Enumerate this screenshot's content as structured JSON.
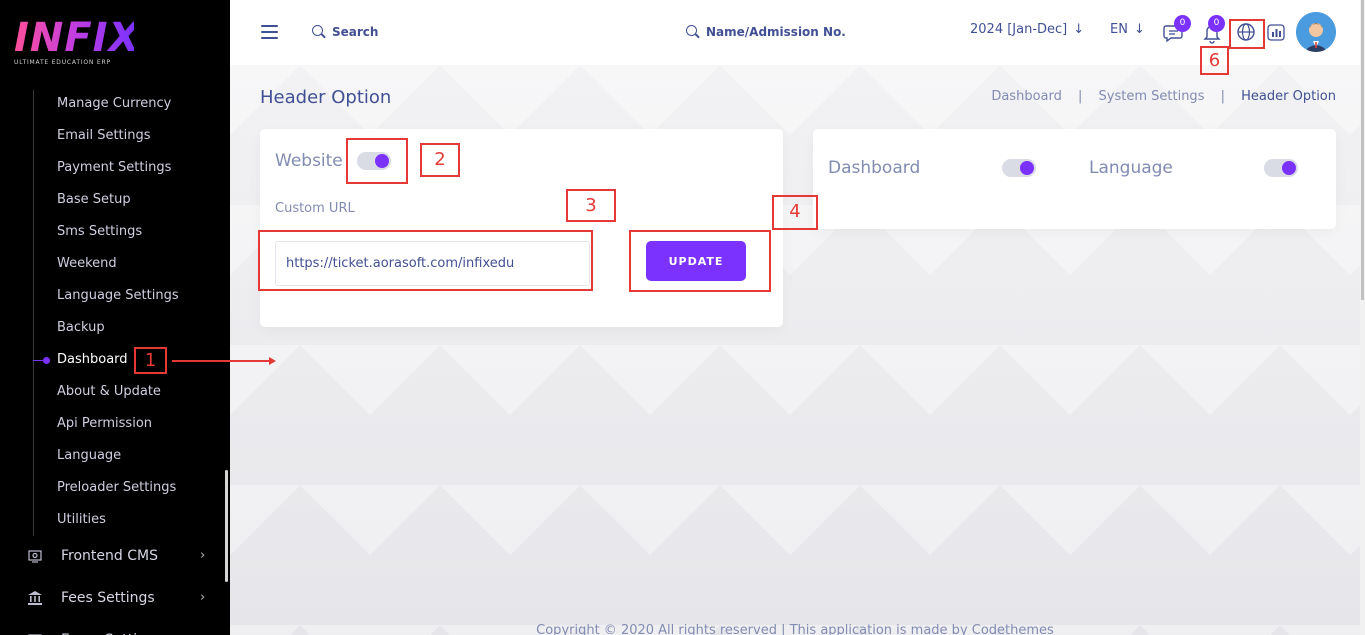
{
  "brand": {
    "logo_text": "INFIX",
    "logo_sub": "ULTIMATE EDUCATION ERP",
    "accent_color": "#7c32ff",
    "annotation_color": "#e53935"
  },
  "sidebar": {
    "submenu": [
      {
        "label": "Manage Currency"
      },
      {
        "label": "Email Settings"
      },
      {
        "label": "Payment Settings"
      },
      {
        "label": "Base Setup"
      },
      {
        "label": "Sms Settings"
      },
      {
        "label": "Weekend"
      },
      {
        "label": "Language Settings"
      },
      {
        "label": "Backup"
      },
      {
        "label": "Dashboard",
        "active": true
      },
      {
        "label": "About & Update"
      },
      {
        "label": "Api Permission"
      },
      {
        "label": "Language"
      },
      {
        "label": "Preloader Settings"
      },
      {
        "label": "Utilities"
      }
    ],
    "groups": [
      {
        "label": "Frontend CMS",
        "icon": "cms-icon"
      },
      {
        "label": "Fees Settings",
        "icon": "bank-icon"
      },
      {
        "label": "Exam Settings",
        "icon": "exam-icon"
      }
    ]
  },
  "header": {
    "search_label": "Search",
    "student_search_label": "Name/Admission No.",
    "academic_year": "2024 [Jan-Dec]",
    "language": "EN",
    "messages_count": "0",
    "notifications_count": "0"
  },
  "page": {
    "title": "Header Option",
    "breadcrumb": [
      "Dashboard",
      "System Settings",
      "Header Option"
    ]
  },
  "card_website": {
    "toggle_label": "Website",
    "toggle_on": true,
    "custom_url_label": "Custom URL",
    "custom_url_value": "https://ticket.aorasoft.com/infixedu",
    "update_label": "UPDATE"
  },
  "card_options": {
    "items": [
      {
        "label": "Dashboard",
        "on": true
      },
      {
        "label": "Language",
        "on": true
      }
    ]
  },
  "annotations": [
    "1",
    "2",
    "3",
    "4",
    "6"
  ],
  "footer": {
    "text": "Copyright © 2020 All rights reserved | This application is made by Codethemes"
  }
}
